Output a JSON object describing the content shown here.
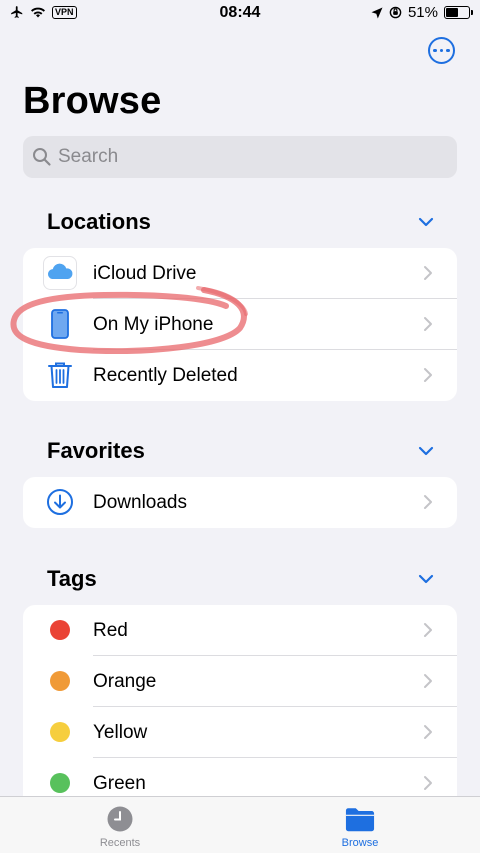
{
  "status_bar": {
    "vpn_label": "VPN",
    "time": "08:44",
    "battery_percent": "51%",
    "battery_level": 0.51
  },
  "title": "Browse",
  "search": {
    "placeholder": "Search"
  },
  "sections": {
    "locations": {
      "title": "Locations",
      "items": [
        {
          "label": "iCloud Drive",
          "icon": "icloud-icon"
        },
        {
          "label": "On My iPhone",
          "icon": "iphone-icon"
        },
        {
          "label": "Recently Deleted",
          "icon": "trash-icon"
        }
      ]
    },
    "favorites": {
      "title": "Favorites",
      "items": [
        {
          "label": "Downloads",
          "icon": "download-circle-icon"
        }
      ]
    },
    "tags": {
      "title": "Tags",
      "items": [
        {
          "label": "Red",
          "color": "#ea4335"
        },
        {
          "label": "Orange",
          "color": "#f09a37"
        },
        {
          "label": "Yellow",
          "color": "#f6ce3e"
        },
        {
          "label": "Green",
          "color": "#58c15c"
        }
      ]
    }
  },
  "tab_bar": {
    "recents_label": "Recents",
    "browse_label": "Browse",
    "active_tab": "Browse"
  },
  "colors": {
    "accent": "#1e6fe0",
    "annotation": "#e8676b"
  }
}
